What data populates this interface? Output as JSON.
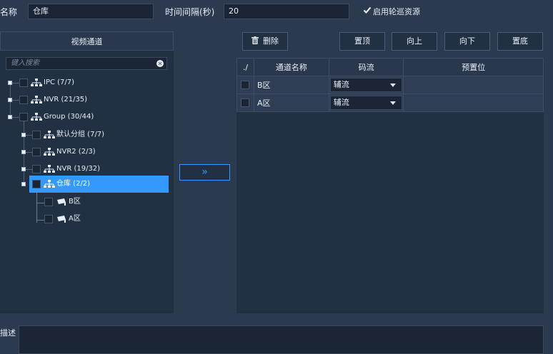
{
  "form": {
    "name_label": "名称",
    "name_value": "仓库",
    "interval_label": "时间间隔(秒)",
    "interval_value": "20",
    "enable_patrol_label": "启用轮巡资源",
    "enable_patrol_checked": true,
    "description_label": "描述",
    "description_value": ""
  },
  "left_panel": {
    "title": "视频通道",
    "search_placeholder": "键入搜索",
    "tree": [
      {
        "label": "IPC (7/7)"
      },
      {
        "label": "NVR (21/35)"
      },
      {
        "label": "Group (30/44)"
      },
      {
        "label": "默认分组 (7/7)"
      },
      {
        "label": "NVR2 (2/3)"
      },
      {
        "label": "NVR (19/32)"
      },
      {
        "label": "仓库 (2/2)",
        "selected": true
      },
      {
        "label": "B区"
      },
      {
        "label": "A区"
      }
    ]
  },
  "transfer_button": "»",
  "toolbar": {
    "delete_label": "删除",
    "top_label": "置顶",
    "up_label": "向上",
    "down_label": "向下",
    "bottom_label": "置底"
  },
  "table": {
    "headers": {
      "check": "./",
      "channel": "通道名称",
      "stream": "码流",
      "preset": "预置位"
    },
    "rows": [
      {
        "channel": "B区",
        "stream": "辅流",
        "preset": ""
      },
      {
        "channel": "A区",
        "stream": "辅流",
        "preset": ""
      }
    ]
  },
  "colors": {
    "selected": "#3399ff",
    "background": "#2c3a50",
    "panel": "#223044"
  }
}
